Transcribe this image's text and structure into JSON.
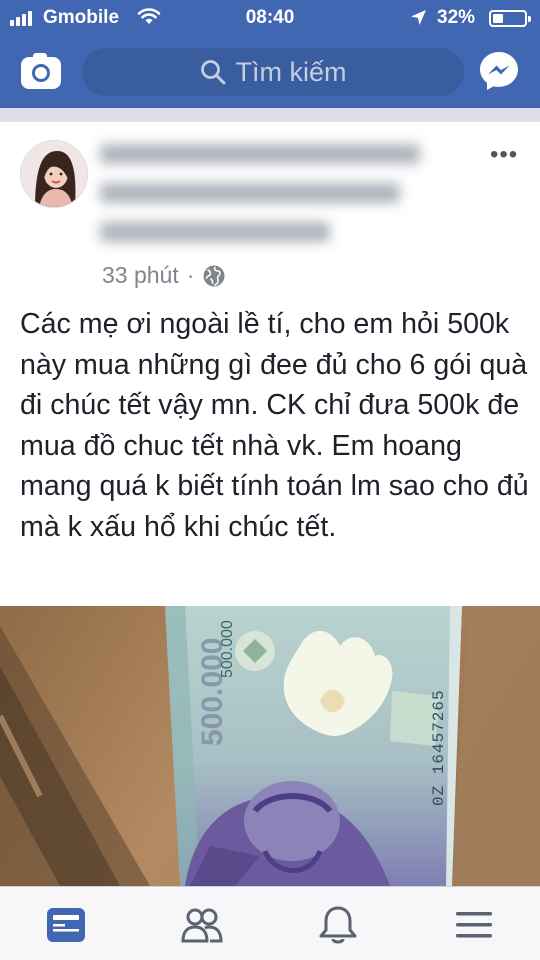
{
  "status_bar": {
    "carrier": "Gmobile",
    "time": "08:40",
    "battery_percent": "32%",
    "battery_level": 0.32,
    "signal_bars": 4
  },
  "header": {
    "search_placeholder": "Tìm kiếm",
    "camera_icon": "camera-icon",
    "messenger_icon": "messenger-icon",
    "background_color": "#4267b2"
  },
  "post": {
    "author_name_blurred": true,
    "time_ago": "33 phút",
    "separator": "·",
    "privacy_icon": "globe-icon",
    "text": "Các mẹ ơi ngoài lề tí,  cho em hỏi 500k này mua những gì đee đủ cho 6 gói quà đi chúc tết vậy mn.  CK chỉ đưa 500k đe mua đồ chuc tết nhà vk.  Em hoang mang quá k biết tính toán lm sao cho đủ mà k xấu hổ khi chúc tết.",
    "image": {
      "banknote_value": "500.000",
      "serial_number": "0Z 16457265"
    }
  },
  "tabbar": {
    "tabs": [
      {
        "icon": "news-feed-icon",
        "active": true
      },
      {
        "icon": "friends-icon",
        "active": false
      },
      {
        "icon": "notifications-bell-icon",
        "active": false
      },
      {
        "icon": "menu-icon",
        "active": false
      }
    ],
    "active_color": "#4267b2",
    "inactive_color": "#5b6270"
  }
}
